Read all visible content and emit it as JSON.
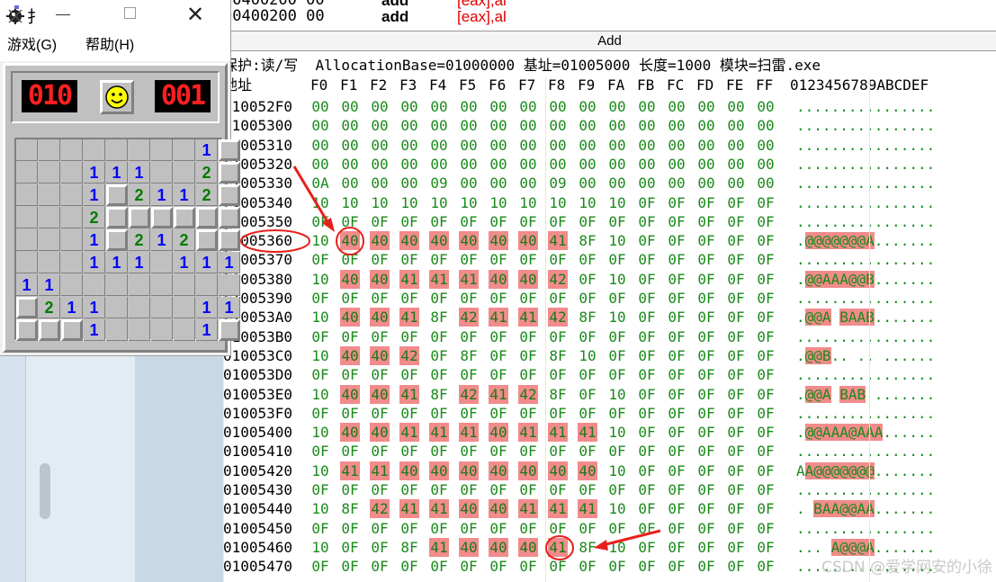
{
  "disasm": {
    "rows": [
      {
        "addr": "00400200 00",
        "mnem": "add",
        "ops_reg": "[eax]",
        "ops_rest": ",al",
        "partial": true
      },
      {
        "addr": "00400200 00",
        "mnem": "add",
        "ops_reg": "[eax]",
        "ops_rest": ",al",
        "partial": false
      }
    ]
  },
  "add_bar_label": "Add",
  "dump_info": "保护:读/写  AllocationBase=01000000 基址=01005000 长度=1000 模块=扫雷.exe",
  "dump_header": {
    "addr": "地址",
    "cols": [
      "F0",
      "F1",
      "F2",
      "F3",
      "F4",
      "F5",
      "F6",
      "F7",
      "F8",
      "F9",
      "FA",
      "FB",
      "FC",
      "FD",
      "FE",
      "FF"
    ],
    "ascii": "0123456789ABCDEF"
  },
  "dump_rows": [
    {
      "addr": "010052F0",
      "bytes": [
        "00",
        "00",
        "00",
        "00",
        "00",
        "00",
        "00",
        "00",
        "00",
        "00",
        "00",
        "00",
        "00",
        "00",
        "00",
        "00"
      ],
      "ascii": "................"
    },
    {
      "addr": "01005300",
      "bytes": [
        "00",
        "00",
        "00",
        "00",
        "00",
        "00",
        "00",
        "00",
        "00",
        "00",
        "00",
        "00",
        "00",
        "00",
        "00",
        "00"
      ],
      "ascii": "................"
    },
    {
      "addr": "01005310",
      "bytes": [
        "00",
        "00",
        "00",
        "00",
        "00",
        "00",
        "00",
        "00",
        "00",
        "00",
        "00",
        "00",
        "00",
        "00",
        "00",
        "00"
      ],
      "ascii": "................"
    },
    {
      "addr": "01005320",
      "bytes": [
        "00",
        "00",
        "00",
        "00",
        "00",
        "00",
        "00",
        "00",
        "00",
        "00",
        "00",
        "00",
        "00",
        "00",
        "00",
        "00"
      ],
      "ascii": "................"
    },
    {
      "addr": "01005330",
      "bytes": [
        "0A",
        "00",
        "00",
        "00",
        "09",
        "00",
        "00",
        "00",
        "09",
        "00",
        "00",
        "00",
        "00",
        "00",
        "00",
        "00"
      ],
      "ascii": "................"
    },
    {
      "addr": "01005340",
      "bytes": [
        "10",
        "10",
        "10",
        "10",
        "10",
        "10",
        "10",
        "10",
        "10",
        "10",
        "10",
        "0F",
        "0F",
        "0F",
        "0F",
        "0F"
      ],
      "ascii": "................"
    },
    {
      "addr": "01005350",
      "bytes": [
        "0F",
        "0F",
        "0F",
        "0F",
        "0F",
        "0F",
        "0F",
        "0F",
        "0F",
        "0F",
        "0F",
        "0F",
        "0F",
        "0F",
        "0F",
        "0F"
      ],
      "ascii": "................"
    },
    {
      "addr": "01005360",
      "bytes": [
        "10",
        "40",
        "40",
        "40",
        "40",
        "40",
        "40",
        "40",
        "41",
        "8F",
        "10",
        "0F",
        "0F",
        "0F",
        "0F",
        "0F"
      ],
      "ascii": ".@@@@@@@A.......",
      "hl": [
        1,
        2,
        3,
        4,
        5,
        6,
        7,
        8
      ]
    },
    {
      "addr": "01005370",
      "bytes": [
        "0F",
        "0F",
        "0F",
        "0F",
        "0F",
        "0F",
        "0F",
        "0F",
        "0F",
        "0F",
        "0F",
        "0F",
        "0F",
        "0F",
        "0F",
        "0F"
      ],
      "ascii": "................"
    },
    {
      "addr": "01005380",
      "bytes": [
        "10",
        "40",
        "40",
        "41",
        "41",
        "41",
        "40",
        "40",
        "42",
        "0F",
        "10",
        "0F",
        "0F",
        "0F",
        "0F",
        "0F"
      ],
      "ascii": ".@@AAA@@B.......",
      "hl": [
        1,
        2,
        3,
        4,
        5,
        6,
        7,
        8
      ]
    },
    {
      "addr": "01005390",
      "bytes": [
        "0F",
        "0F",
        "0F",
        "0F",
        "0F",
        "0F",
        "0F",
        "0F",
        "0F",
        "0F",
        "0F",
        "0F",
        "0F",
        "0F",
        "0F",
        "0F"
      ],
      "ascii": "................"
    },
    {
      "addr": "010053A0",
      "bytes": [
        "10",
        "40",
        "40",
        "41",
        "8F",
        "42",
        "41",
        "41",
        "42",
        "8F",
        "10",
        "0F",
        "0F",
        "0F",
        "0F",
        "0F"
      ],
      "ascii": ".@@A BAAB.......",
      "hl": [
        1,
        2,
        3,
        5,
        6,
        7,
        8
      ]
    },
    {
      "addr": "010053B0",
      "bytes": [
        "0F",
        "0F",
        "0F",
        "0F",
        "0F",
        "0F",
        "0F",
        "0F",
        "0F",
        "0F",
        "0F",
        "0F",
        "0F",
        "0F",
        "0F",
        "0F"
      ],
      "ascii": "................"
    },
    {
      "addr": "010053C0",
      "bytes": [
        "10",
        "40",
        "40",
        "42",
        "0F",
        "8F",
        "0F",
        "0F",
        "8F",
        "10",
        "0F",
        "0F",
        "0F",
        "0F",
        "0F",
        "0F"
      ],
      "ascii": ".@@B.. .. ......",
      "hl": [
        1,
        2,
        3
      ]
    },
    {
      "addr": "010053D0",
      "bytes": [
        "0F",
        "0F",
        "0F",
        "0F",
        "0F",
        "0F",
        "0F",
        "0F",
        "0F",
        "0F",
        "0F",
        "0F",
        "0F",
        "0F",
        "0F",
        "0F"
      ],
      "ascii": "................"
    },
    {
      "addr": "010053E0",
      "bytes": [
        "10",
        "40",
        "40",
        "41",
        "8F",
        "42",
        "41",
        "42",
        "8F",
        "0F",
        "10",
        "0F",
        "0F",
        "0F",
        "0F",
        "0F"
      ],
      "ascii": ".@@A BAB .......",
      "hl": [
        1,
        2,
        3,
        5,
        6,
        7
      ]
    },
    {
      "addr": "010053F0",
      "bytes": [
        "0F",
        "0F",
        "0F",
        "0F",
        "0F",
        "0F",
        "0F",
        "0F",
        "0F",
        "0F",
        "0F",
        "0F",
        "0F",
        "0F",
        "0F",
        "0F"
      ],
      "ascii": "................"
    },
    {
      "addr": "01005400",
      "bytes": [
        "10",
        "40",
        "40",
        "41",
        "41",
        "41",
        "40",
        "41",
        "41",
        "41",
        "10",
        "0F",
        "0F",
        "0F",
        "0F",
        "0F"
      ],
      "ascii": ".@@AAA@AAA......",
      "hl": [
        1,
        2,
        3,
        4,
        5,
        6,
        7,
        8,
        9
      ]
    },
    {
      "addr": "01005410",
      "bytes": [
        "0F",
        "0F",
        "0F",
        "0F",
        "0F",
        "0F",
        "0F",
        "0F",
        "0F",
        "0F",
        "0F",
        "0F",
        "0F",
        "0F",
        "0F",
        "0F"
      ],
      "ascii": "................"
    },
    {
      "addr": "01005420",
      "bytes": [
        "10",
        "41",
        "41",
        "40",
        "40",
        "40",
        "40",
        "40",
        "40",
        "40",
        "10",
        "0F",
        "0F",
        "0F",
        "0F",
        "0F"
      ],
      "ascii": "AA@@@@@@@.......",
      "hl": [
        1,
        2,
        3,
        4,
        5,
        6,
        7,
        8,
        9
      ]
    },
    {
      "addr": "01005430",
      "bytes": [
        "0F",
        "0F",
        "0F",
        "0F",
        "0F",
        "0F",
        "0F",
        "0F",
        "0F",
        "0F",
        "0F",
        "0F",
        "0F",
        "0F",
        "0F",
        "0F"
      ],
      "ascii": "................"
    },
    {
      "addr": "01005440",
      "bytes": [
        "10",
        "8F",
        "42",
        "41",
        "41",
        "40",
        "40",
        "41",
        "41",
        "41",
        "10",
        "0F",
        "0F",
        "0F",
        "0F",
        "0F"
      ],
      "ascii": ". BAA@@AA.......",
      "hl": [
        2,
        3,
        4,
        5,
        6,
        7,
        8,
        9
      ]
    },
    {
      "addr": "01005450",
      "bytes": [
        "0F",
        "0F",
        "0F",
        "0F",
        "0F",
        "0F",
        "0F",
        "0F",
        "0F",
        "0F",
        "0F",
        "0F",
        "0F",
        "0F",
        "0F",
        "0F"
      ],
      "ascii": "................"
    },
    {
      "addr": "01005460",
      "bytes": [
        "10",
        "0F",
        "0F",
        "8F",
        "41",
        "40",
        "40",
        "40",
        "41",
        "8F",
        "10",
        "0F",
        "0F",
        "0F",
        "0F",
        "0F"
      ],
      "ascii": "... A@@@A.......",
      "hl": [
        4,
        5,
        6,
        7,
        8
      ]
    },
    {
      "addr": "01005470",
      "bytes": [
        "0F",
        "0F",
        "0F",
        "0F",
        "0F",
        "0F",
        "0F",
        "0F",
        "0F",
        "0F",
        "0F",
        "0F",
        "0F",
        "0F",
        "0F",
        "0F"
      ],
      "ascii": "................"
    }
  ],
  "minesweeper": {
    "title_glyph": "扌",
    "menu": [
      "游戏(G)",
      "帮助(H)"
    ],
    "mine_counter": "010",
    "timer": "001",
    "face": "☺",
    "grid_rows": [
      "?????????  1?",
      "",
      ""
    ],
    "board": [
      [
        "c",
        "c",
        "c",
        "c",
        "c",
        "c",
        "c",
        "c",
        "1",
        "c"
      ],
      [
        "c",
        "c",
        "c",
        "1",
        "1",
        "1",
        "c",
        "c",
        "2",
        "c"
      ],
      [
        "c",
        "c",
        "c",
        "1",
        "c",
        "2",
        "1",
        "1",
        "2",
        "c"
      ],
      [
        "c",
        "c",
        "c",
        "2",
        "c",
        "c",
        "c",
        "c",
        "c",
        "c"
      ],
      [
        "c",
        "c",
        "c",
        "1",
        "c",
        "2",
        "1",
        "2",
        "c",
        "c"
      ],
      [
        "c",
        "c",
        "c",
        "1",
        "1",
        "1",
        "c",
        "1",
        "1",
        "1"
      ],
      [
        "1",
        "1",
        "c",
        "c",
        "c",
        "c",
        "c",
        "c",
        "c",
        "c"
      ],
      [
        "c",
        "2",
        "1",
        "1",
        "c",
        "c",
        "c",
        "c",
        "1",
        "1"
      ],
      [
        "c",
        "c",
        "c",
        "1",
        "c",
        "c",
        "c",
        "c",
        "1",
        "c"
      ]
    ]
  },
  "watermark": "CSDN @爱学网安的小徐",
  "colors": {
    "byte_green": "#1a8a1a",
    "highlight": "#f28b8b",
    "annotation_red": "#e8201c",
    "n1": "#0000ff",
    "n2": "#007b00"
  },
  "icons": [
    "minesweeper-app-icon",
    "minimize-icon",
    "maximize-icon",
    "close-icon",
    "smiley-face-icon",
    "red-arrow-icon",
    "red-circle-icon"
  ]
}
